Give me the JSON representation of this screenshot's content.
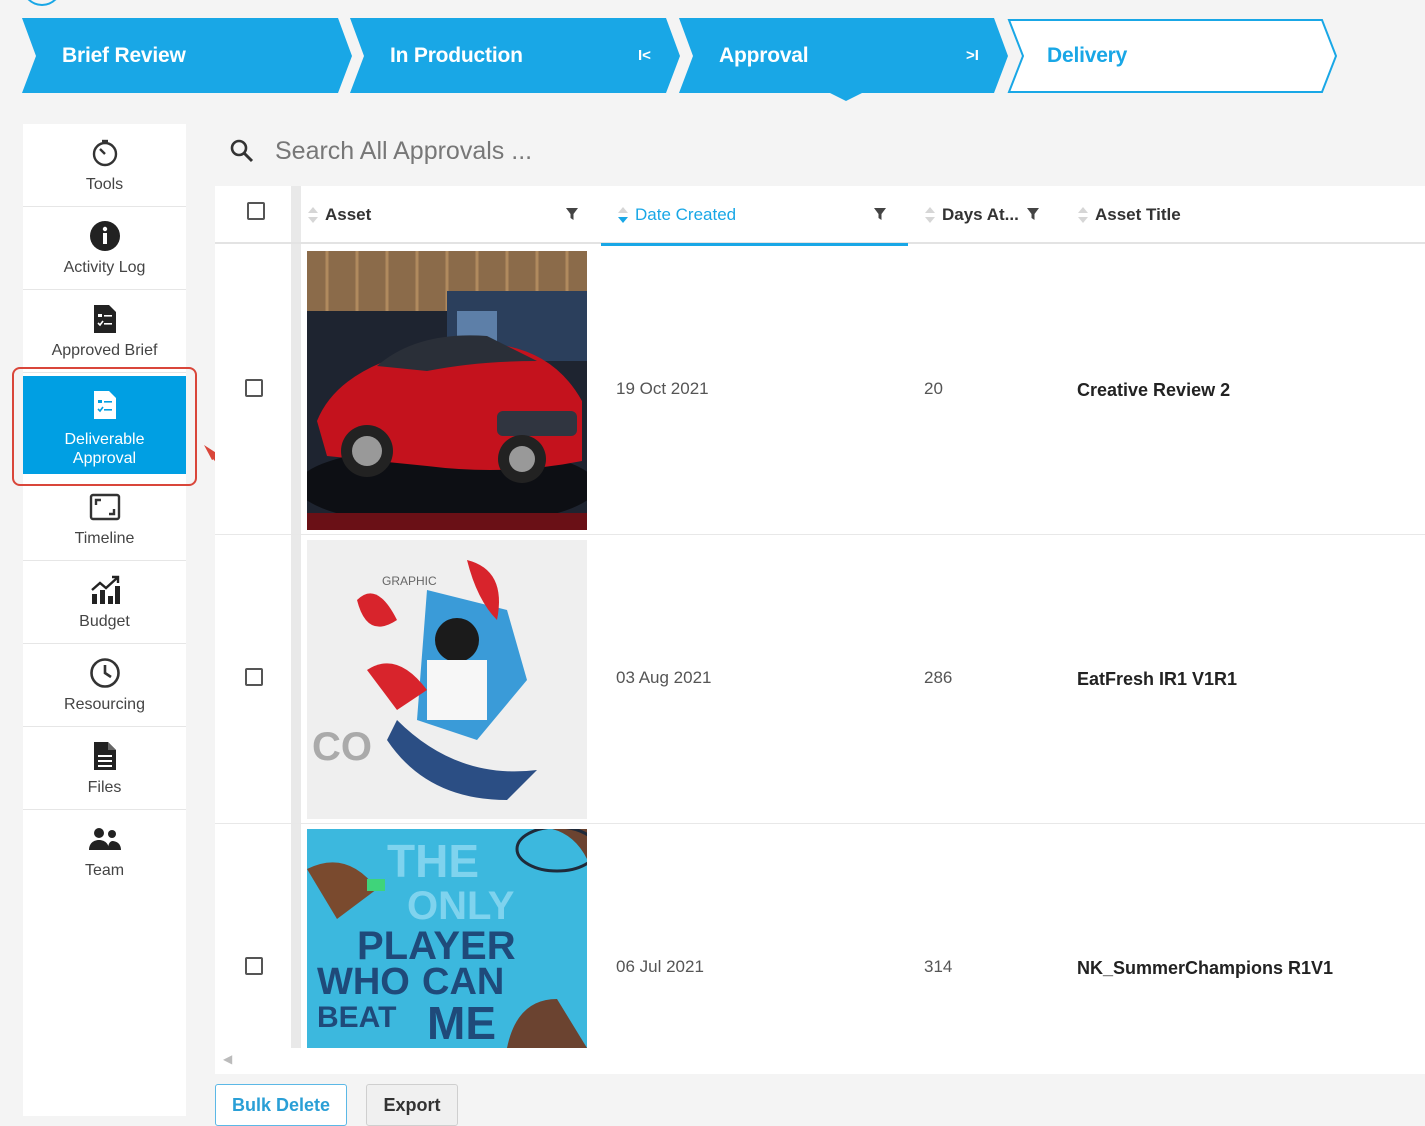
{
  "stages": [
    {
      "label": "Brief Review",
      "state": "done"
    },
    {
      "label": "In Production",
      "state": "done",
      "control": "I<"
    },
    {
      "label": "Approval",
      "state": "current",
      "control": ">I"
    },
    {
      "label": "Delivery",
      "state": "upcoming"
    }
  ],
  "colors": {
    "accent": "#009fe3",
    "stage": "#19a7e6",
    "annotation": "#d9463a"
  },
  "sidebar": {
    "items": [
      {
        "label": "Tools",
        "icon": "timer-icon"
      },
      {
        "label": "Activity Log",
        "icon": "info-icon"
      },
      {
        "label": "Approved Brief",
        "icon": "checklist-document-icon"
      },
      {
        "label": "Deliverable Approval",
        "icon": "checklist-document-icon",
        "active": true
      },
      {
        "label": "Timeline",
        "icon": "frame-icon"
      },
      {
        "label": "Budget",
        "icon": "bar-chart-icon"
      },
      {
        "label": "Resourcing",
        "icon": "clock-icon"
      },
      {
        "label": "Files",
        "icon": "file-icon"
      },
      {
        "label": "Team",
        "icon": "people-icon"
      }
    ]
  },
  "search": {
    "placeholder": "Search All Approvals ..."
  },
  "table": {
    "columns": [
      "Asset",
      "Date Created",
      "Days At...",
      "Asset Title"
    ],
    "rows": [
      {
        "date": "19 Oct 2021",
        "days": "20",
        "title": "Creative Review 2",
        "thumb": "red-car-photo"
      },
      {
        "date": "03 Aug 2021",
        "days": "286",
        "title": "EatFresh IR1 V1R1",
        "thumb": "graphic-poster"
      },
      {
        "date": "06 Jul 2021",
        "days": "314",
        "title": "NK_SummerChampions R1V1",
        "thumb": "tennis-poster"
      }
    ]
  },
  "buttons": {
    "bulk_delete": "Bulk Delete",
    "export": "Export"
  }
}
